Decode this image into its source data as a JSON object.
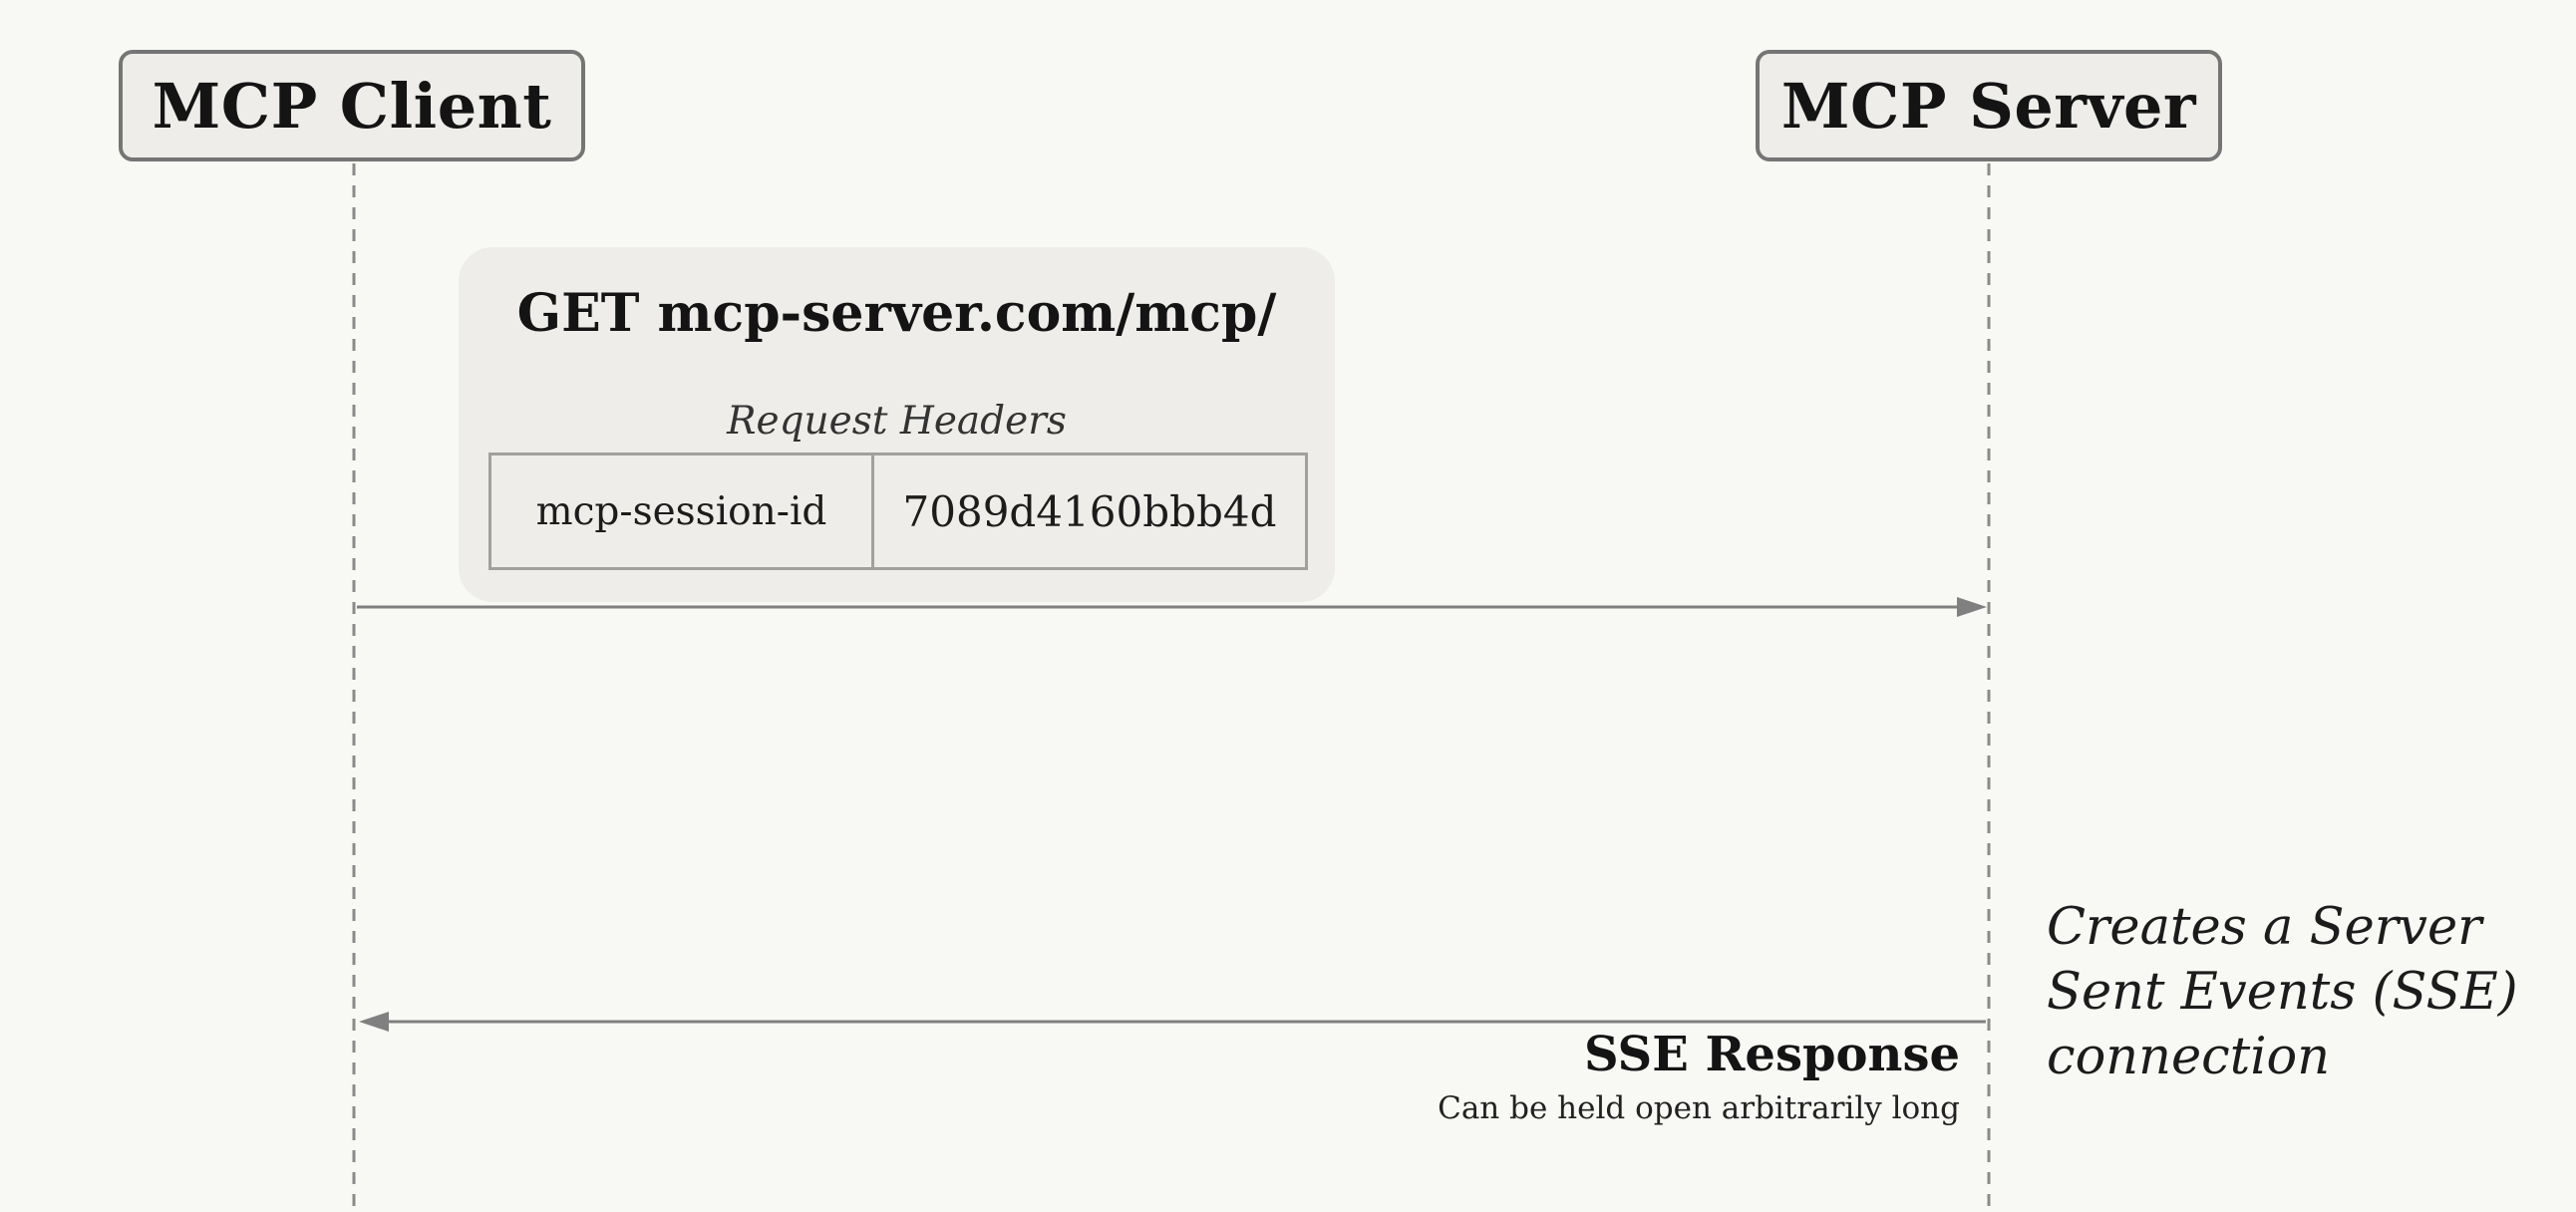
{
  "participants": {
    "client": "MCP Client",
    "server": "MCP Server"
  },
  "request": {
    "title": "GET mcp-server.com/mcp/",
    "headers_caption": "Request Headers",
    "headers": [
      {
        "key": "mcp-session-id",
        "value": "7089d4160bbb4d"
      }
    ]
  },
  "response": {
    "title": "SSE Response",
    "subtitle": "Can be held open arbitrarily long"
  },
  "server_note": {
    "line1": "Creates a Server",
    "line2": "Sent Events (SSE)",
    "line3": "connection"
  },
  "colors": {
    "background": "#f8f9f5",
    "box_fill": "#eeede9",
    "box_border": "#757575",
    "line": "#808080"
  }
}
